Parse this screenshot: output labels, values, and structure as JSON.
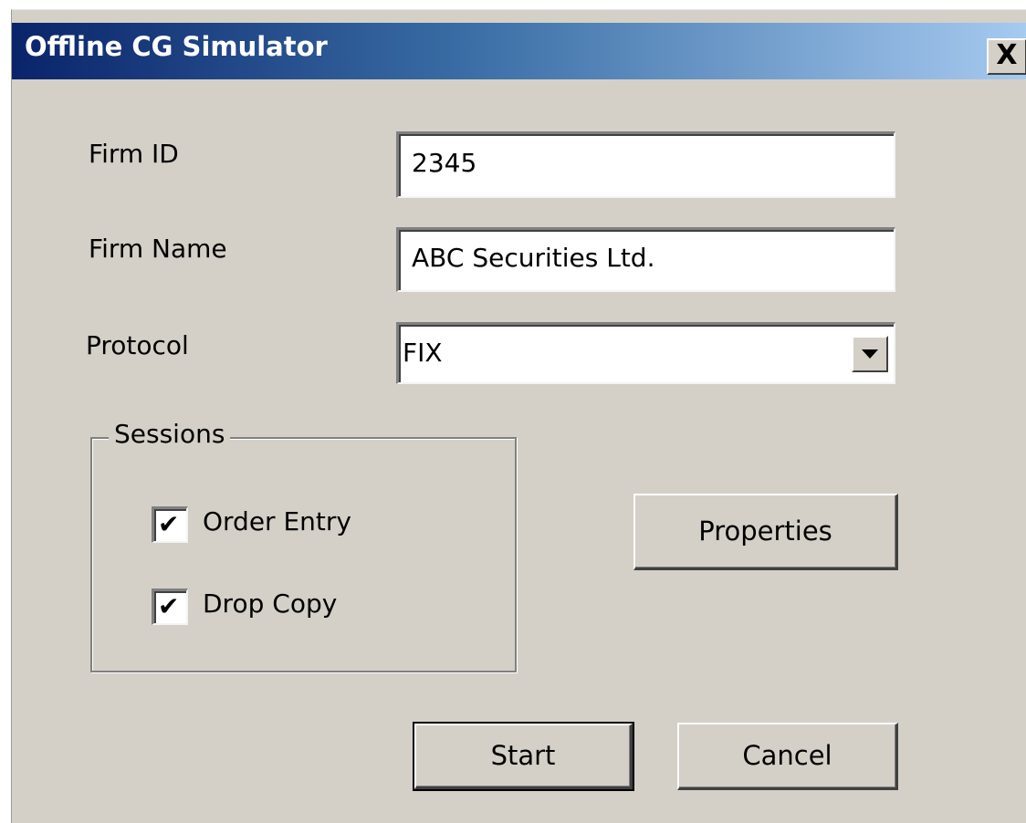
{
  "window": {
    "title": "Offline CG Simulator",
    "close_label": "X"
  },
  "form": {
    "firm_id_label": "Firm ID",
    "firm_id_value": "2345",
    "firm_name_label": "Firm Name",
    "firm_name_value": "ABC Securities Ltd.",
    "protocol_label": "Protocol",
    "protocol_value": "FIX"
  },
  "sessions": {
    "legend": "Sessions",
    "items": [
      {
        "label": "Order Entry",
        "checked": true
      },
      {
        "label": "Drop Copy",
        "checked": true
      }
    ]
  },
  "buttons": {
    "properties": "Properties",
    "start": "Start",
    "cancel": "Cancel"
  },
  "colors": {
    "titlebar_start": "#0a246a",
    "titlebar_end": "#a6caf0",
    "face": "#d4d0c8"
  }
}
